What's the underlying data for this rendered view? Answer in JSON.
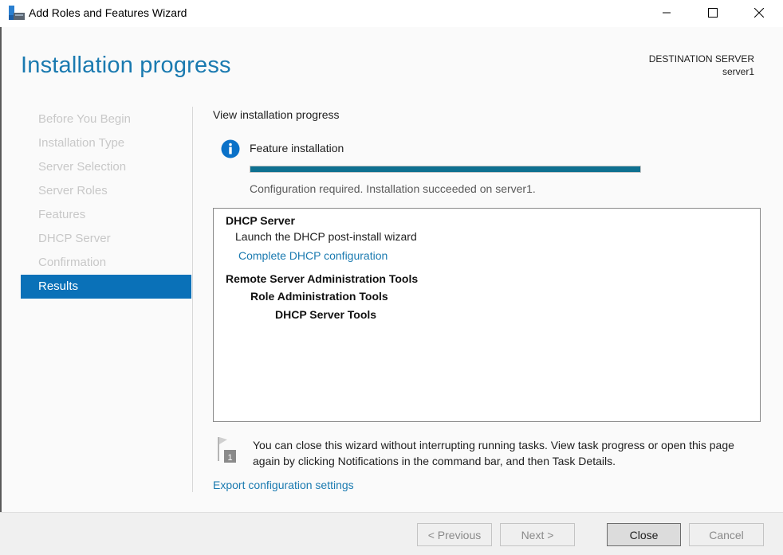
{
  "window": {
    "title": "Add Roles and Features Wizard",
    "controls": {
      "minimize": "minimize",
      "maximize": "maximize",
      "close": "close"
    }
  },
  "header": {
    "page_title": "Installation progress",
    "destination_label": "DESTINATION SERVER",
    "destination_server": "server1"
  },
  "nav": {
    "items": [
      {
        "label": "Before You Begin",
        "active": false
      },
      {
        "label": "Installation Type",
        "active": false
      },
      {
        "label": "Server Selection",
        "active": false
      },
      {
        "label": "Server Roles",
        "active": false
      },
      {
        "label": "Features",
        "active": false
      },
      {
        "label": "DHCP Server",
        "active": false
      },
      {
        "label": "Confirmation",
        "active": false
      },
      {
        "label": "Results",
        "active": true
      }
    ]
  },
  "main": {
    "section_heading": "View installation progress",
    "feature_label": "Feature installation",
    "progress_percent": 100,
    "progress_color": "#0e7090",
    "status_text": "Configuration required. Installation succeeded on server1.",
    "results": {
      "dhcp_title": "DHCP Server",
      "dhcp_desc": "Launch the DHCP post-install wizard",
      "dhcp_link": "Complete DHCP configuration",
      "rsat_title": "Remote Server Administration Tools",
      "rsat_role": "Role Administration Tools",
      "rsat_dhcp": "DHCP Server Tools"
    },
    "notice_badge": "1",
    "notice_text": "You can close this wizard without interrupting running tasks. View task progress or open this page again by clicking Notifications in the command bar, and then Task Details.",
    "export_link": "Export configuration settings"
  },
  "footer": {
    "previous": "< Previous",
    "next": "Next >",
    "close": "Close",
    "cancel": "Cancel"
  },
  "colors": {
    "accent": "#1a7ab0",
    "nav_active": "#0a71b8"
  }
}
